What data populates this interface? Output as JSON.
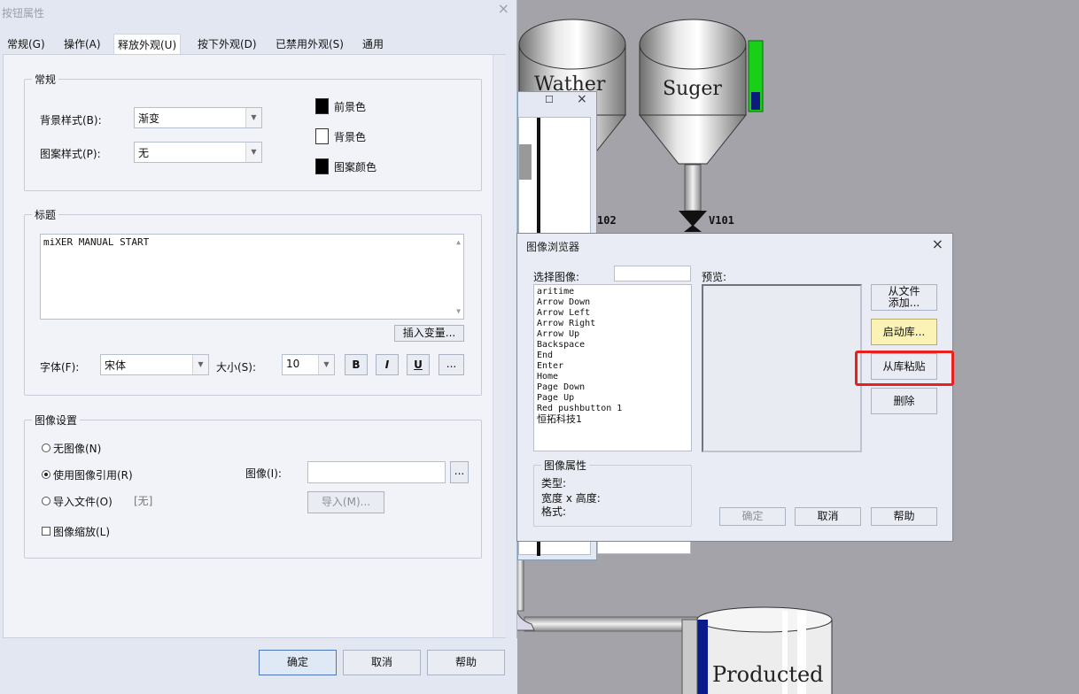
{
  "properties_dialog": {
    "title": "按钮属性",
    "tabs": [
      "常规(G)",
      "操作(A)",
      "释放外观(U)",
      "按下外观(D)",
      "已禁用外观(S)",
      "通用"
    ],
    "general_group": {
      "title": "常规",
      "bg_style_label": "背景样式(B):",
      "bg_style_value": "渐变",
      "pattern_style_label": "图案样式(P):",
      "pattern_style_value": "无",
      "fg_color_label": "前景色",
      "bg_color_label": "背景色",
      "pattern_color_label": "图案颜色",
      "fg_color": "#000000",
      "bg_color": "#ffffff",
      "pattern_color": "#000000"
    },
    "caption_group": {
      "title": "标题",
      "text": "miXER MANUAL START",
      "insert_var_button": "插入变量...",
      "font_label": "字体(F):",
      "font_value": "宋体",
      "size_label": "大小(S):",
      "size_value": "10",
      "bold": "B",
      "italic": "I",
      "underline": "U",
      "more": "..."
    },
    "image_group": {
      "title": "图像设置",
      "no_image": "无图像(N)",
      "use_image_ref": "使用图像引用(R)",
      "import_file": "导入文件(O)",
      "none_text": "[无]",
      "image_label": "图像(I):",
      "image_value": "",
      "browse": "...",
      "import_button": "导入(M)...",
      "scale_image": "图像缩放(L)"
    },
    "ok": "确定",
    "cancel": "取消",
    "help": "帮助"
  },
  "image_browser": {
    "title": "图像浏览器",
    "select_label": "选择图像:",
    "filter_value": "",
    "preview_label": "预览:",
    "images": [
      "aritime",
      "Arrow Down",
      "Arrow Left",
      "Arrow Right",
      "Arrow Up",
      "Backspace",
      "End",
      "Enter",
      "Home",
      "Page Down",
      "Page Up",
      "Red pushbutton 1",
      "恒拓科技1"
    ],
    "add_from_file_line1": "从文件",
    "add_from_file_line2": "添加...",
    "launch_library": "启动库...",
    "paste_from_library": "从库粘贴",
    "delete": "删除",
    "props_title": "图像属性",
    "type_label": "类型:",
    "size_label": "宽度 x 高度:",
    "format_label": "格式:",
    "ok": "确定",
    "cancel": "取消",
    "help": "帮助"
  },
  "scene": {
    "tank1_label": "Wather",
    "tank2_label": "Suger",
    "tank3_label": "Producted",
    "valve_label": "V101",
    "valve2_label": "102"
  }
}
